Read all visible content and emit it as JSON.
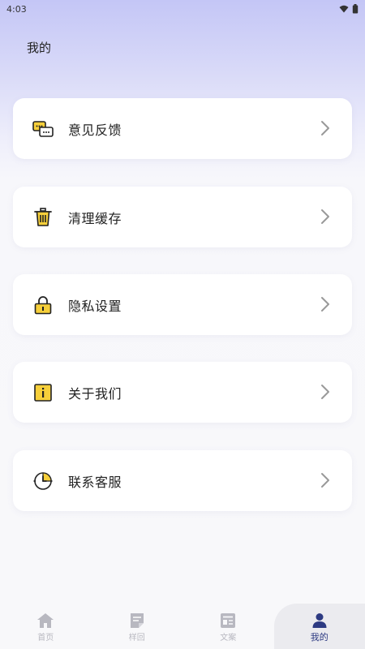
{
  "status_bar": {
    "time": "4:03"
  },
  "header": {
    "title": "我的"
  },
  "menu": [
    {
      "label": "意见反馈",
      "icon": "feedback-chat-icon"
    },
    {
      "label": "清理缓存",
      "icon": "trash-icon"
    },
    {
      "label": "隐私设置",
      "icon": "lock-icon"
    },
    {
      "label": "关于我们",
      "icon": "info-icon"
    },
    {
      "label": "联系客服",
      "icon": "clock-service-icon"
    }
  ],
  "tabs": [
    {
      "label": "首页",
      "icon": "home-icon",
      "active": false
    },
    {
      "label": "样回",
      "icon": "note-icon",
      "active": false
    },
    {
      "label": "文案",
      "icon": "document-icon",
      "active": false
    },
    {
      "label": "我的",
      "icon": "person-icon",
      "active": true
    }
  ],
  "colors": {
    "accent": "#2d3a82",
    "icon_yellow": "#f6cf3a",
    "tab_inactive": "#b8b8c0"
  }
}
